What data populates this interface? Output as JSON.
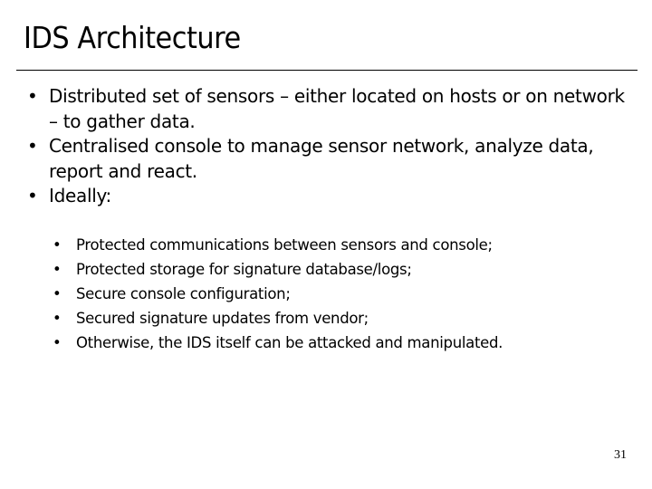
{
  "slide": {
    "title": "IDS Architecture",
    "bullets": [
      "Distributed set of sensors – either located on hosts or on network – to gather data.",
      "Centralised console to manage sensor network, analyze data, report and react.",
      "Ideally:"
    ],
    "sub_bullets": [
      "Protected communications between sensors and console;",
      "Protected storage for signature database/logs;",
      "Secure console configuration;",
      "Secured signature updates from vendor;",
      "Otherwise, the IDS itself can be attacked and manipulated."
    ],
    "bullet_glyph": "•",
    "page_number": "31"
  }
}
